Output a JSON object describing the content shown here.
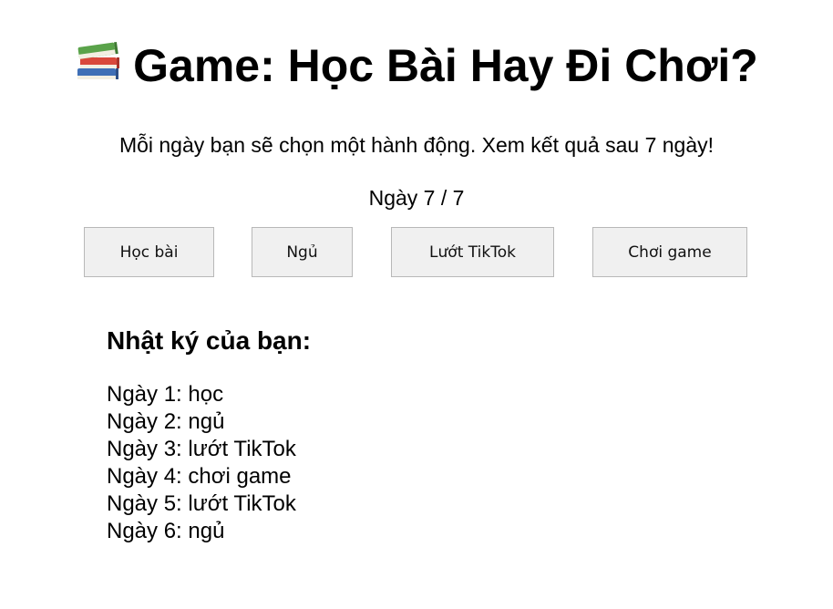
{
  "header": {
    "icon": "books-icon",
    "title": "Game: Học Bài Hay Đi Chơi?"
  },
  "intro": {
    "text": "Mỗi ngày bạn sẽ chọn một hành động. Xem kết quả sau 7 ngày!"
  },
  "progress": {
    "label": "Ngày 7 / 7",
    "current_day": 7,
    "total_days": 7
  },
  "actions": [
    {
      "label": "Học bài"
    },
    {
      "label": "Ngủ"
    },
    {
      "label": "Lướt TikTok"
    },
    {
      "label": "Chơi game"
    }
  ],
  "journal": {
    "title": "Nhật ký của bạn:",
    "entries": [
      "Ngày 1: học",
      "Ngày 2: ngủ",
      "Ngày 3: lướt TikTok",
      "Ngày 4: chơi game",
      "Ngày 5: lướt TikTok",
      "Ngày 6: ngủ"
    ]
  }
}
